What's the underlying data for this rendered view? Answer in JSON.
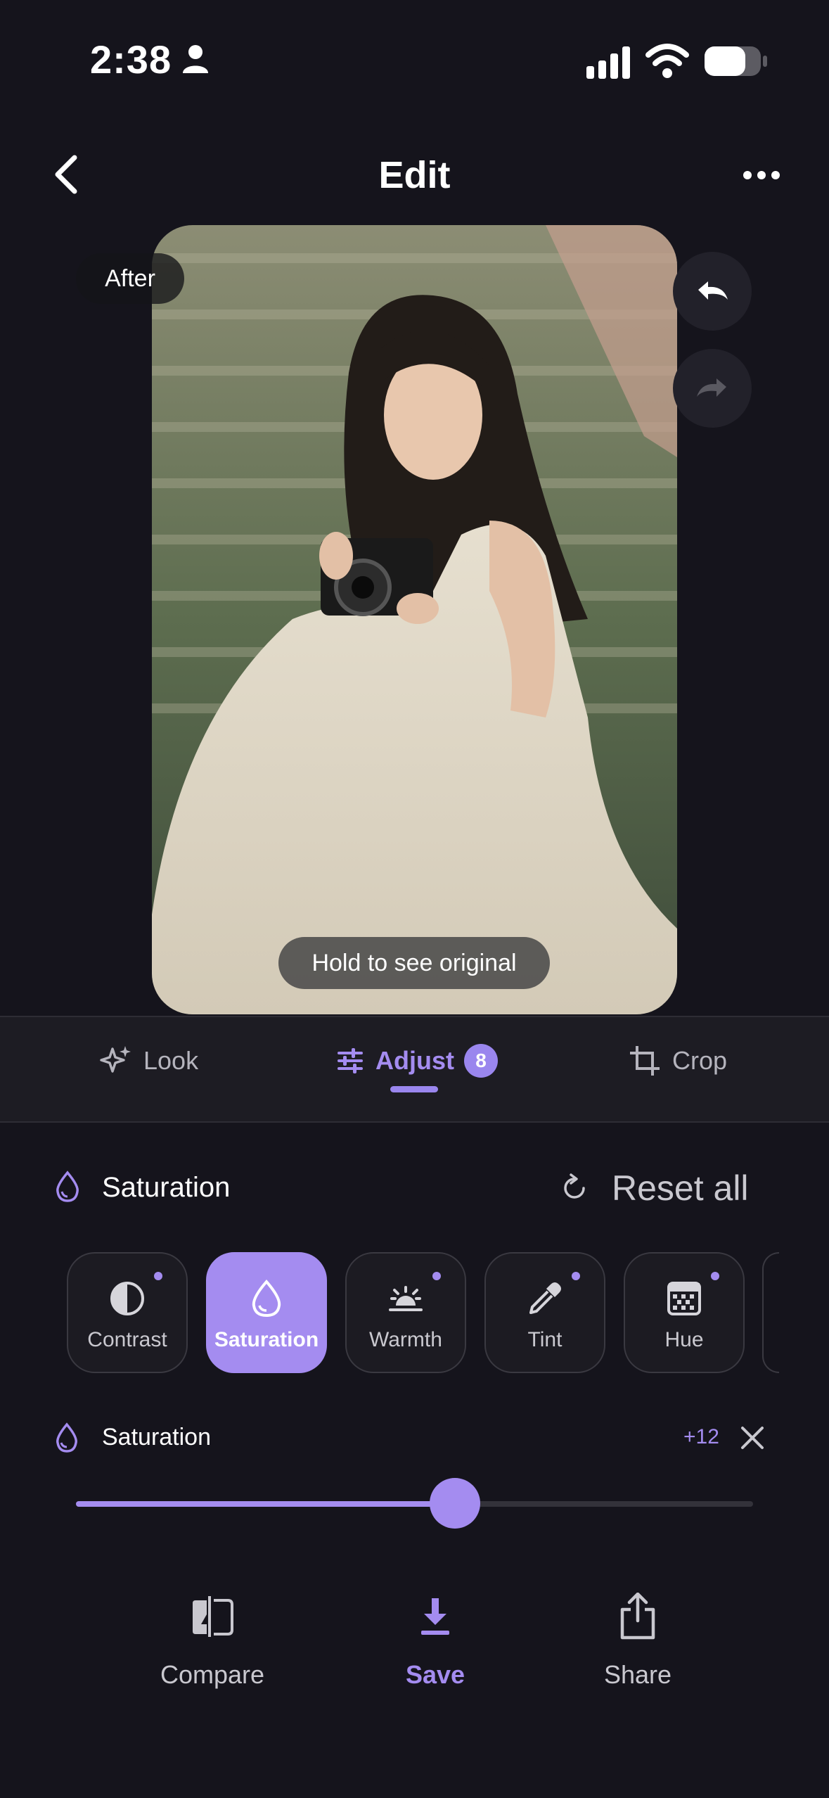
{
  "status_bar": {
    "time": "2:38"
  },
  "header": {
    "title": "Edit"
  },
  "photo": {
    "after_label": "After",
    "hold_hint": "Hold to see original"
  },
  "tabs": [
    {
      "label": "Look"
    },
    {
      "label": "Adjust",
      "badge": "8"
    },
    {
      "label": "Crop"
    }
  ],
  "section": {
    "label": "Saturation",
    "reset_label": "Reset all"
  },
  "tools": [
    {
      "label": "Contrast"
    },
    {
      "label": "Saturation"
    },
    {
      "label": "Warmth"
    },
    {
      "label": "Tint"
    },
    {
      "label": "Hue"
    }
  ],
  "slider": {
    "label": "Saturation",
    "value_text": "+12",
    "fill_fraction": 0.56
  },
  "actions": [
    {
      "label": "Compare"
    },
    {
      "label": "Save"
    },
    {
      "label": "Share"
    }
  ],
  "colors": {
    "accent": "#a48cf0",
    "background": "#15141c"
  }
}
